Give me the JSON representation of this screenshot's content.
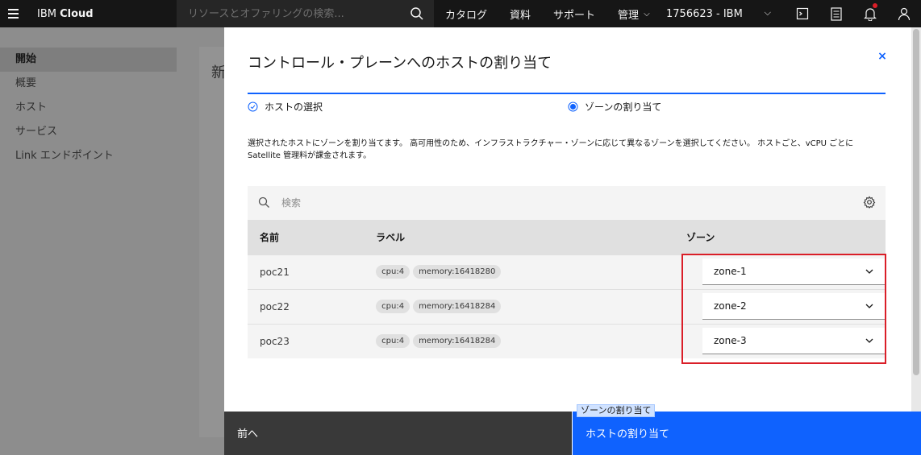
{
  "header": {
    "brand_prefix": "IBM",
    "brand_name": "Cloud",
    "search_placeholder": "リソースとオファリングの検索...",
    "nav": [
      "カタログ",
      "資料",
      "サポート",
      "管理"
    ],
    "account": "1756623 - IBM"
  },
  "sidebar": {
    "items": [
      "開始",
      "概要",
      "ホスト",
      "サービス",
      "Link エンドポイント"
    ]
  },
  "background": {
    "title_fragment": "新"
  },
  "modal": {
    "title": "コントロール・プレーンへのホストの割り当て",
    "close_label": "×",
    "steps": [
      {
        "label": "ホストの選択",
        "state": "complete"
      },
      {
        "label": "ゾーンの割り当て",
        "state": "current"
      }
    ],
    "description": "選択されたホストにゾーンを割り当てます。 高可用性のため、インフラストラクチャー・ゾーンに応じて異なるゾーンを選択してください。 ホストごと、vCPU ごとに Satellite 管理料が課金されます。",
    "search_placeholder": "検索",
    "table": {
      "headers": [
        "名前",
        "ラベル",
        "ゾーン"
      ],
      "rows": [
        {
          "name": "poc21",
          "labels": [
            "cpu:4",
            "memory:16418280"
          ],
          "zone": "zone-1"
        },
        {
          "name": "poc22",
          "labels": [
            "cpu:4",
            "memory:16418284"
          ],
          "zone": "zone-2"
        },
        {
          "name": "poc23",
          "labels": [
            "cpu:4",
            "memory:16418284"
          ],
          "zone": "zone-3"
        }
      ]
    }
  },
  "footer": {
    "prev_label": "前へ",
    "next_label": "ホストの割り当て",
    "tooltip": "ゾーンの割り当て"
  },
  "colors": {
    "primary": "#0f62fe",
    "highlight": "#da1e28",
    "topbar": "#161616"
  }
}
